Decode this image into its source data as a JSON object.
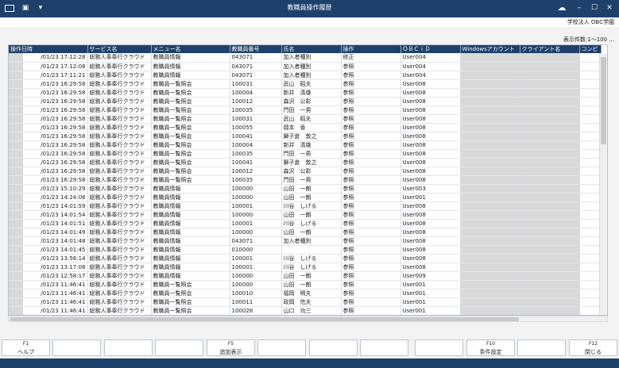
{
  "window": {
    "title": "教職員操作履歴",
    "icons": [
      "window-icon",
      "app-icon",
      "menu-icon"
    ],
    "org": "学校法人 OBC学園",
    "count": "表示件数:1～100 ..."
  },
  "columns": [
    "操作日時",
    "サービス名",
    "メニュー名",
    "教職員番号",
    "氏名",
    "操作",
    "ＯＢＣｉＤ",
    "Windowsアカウント",
    "クライアント名",
    "コンピ"
  ],
  "rows": [
    [
      "/01/23 17:12:28",
      "総務人事奉行クラウド",
      "教職員情報",
      "043071",
      "加入者種別",
      "修正",
      "User004"
    ],
    [
      "/01/23 17:12:08",
      "総務人事奉行クラウド",
      "教職員情報",
      "043071",
      "加入者種別",
      "参照",
      "User004"
    ],
    [
      "/01/23 17:11:21",
      "総務人事奉行クラウド",
      "教職員情報",
      "043071",
      "加入者種別",
      "参照",
      "User004"
    ],
    [
      "/01/23 16:29:58",
      "総務人事奉行クラウド",
      "教職員一覧照会",
      "100031",
      "武山　昭夫",
      "参照",
      "User008"
    ],
    [
      "/01/23 16:29:58",
      "総務人事奉行クラウド",
      "教職員一覧照会",
      "100004",
      "新井　清雄",
      "参照",
      "User008"
    ],
    [
      "/01/23 16:29:58",
      "総務人事奉行クラウド",
      "教職員一覧照会",
      "100012",
      "森沢　公彰",
      "参照",
      "User008"
    ],
    [
      "/01/23 16:29:58",
      "総務人事奉行クラウド",
      "教職員一覧照会",
      "100035",
      "門田　一男",
      "参照",
      "User008"
    ],
    [
      "/01/23 16:29:58",
      "総務人事奉行クラウド",
      "教職員一覧照会",
      "100031",
      "武山　昭夫",
      "参照",
      "User008"
    ],
    [
      "/01/23 16:29:58",
      "総務人事奉行クラウド",
      "教職員一覧照会",
      "100055",
      "岡本　香",
      "参照",
      "User008"
    ],
    [
      "/01/23 16:29:58",
      "総務人事奉行クラウド",
      "教職員一覧照会",
      "100041",
      "獅子倉　敦之",
      "参照",
      "User008"
    ],
    [
      "/01/23 16:29:58",
      "総務人事奉行クラウド",
      "教職員一覧照会",
      "100004",
      "新井　清雄",
      "参照",
      "User008"
    ],
    [
      "/01/23 16:29:58",
      "総務人事奉行クラウド",
      "教職員一覧照会",
      "100035",
      "門田　一男",
      "参照",
      "User008"
    ],
    [
      "/01/23 16:29:58",
      "総務人事奉行クラウド",
      "教職員一覧照会",
      "100041",
      "獅子倉　敦之",
      "参照",
      "User008"
    ],
    [
      "/01/23 16:29:58",
      "総務人事奉行クラウド",
      "教職員一覧照会",
      "100012",
      "森沢　公彰",
      "参照",
      "User008"
    ],
    [
      "/01/23 16:29:58",
      "総務人事奉行クラウド",
      "教職員一覧照会",
      "100035",
      "門田　一男",
      "参照",
      "User008"
    ],
    [
      "/01/23 15:10:29",
      "総務人事奉行クラウド",
      "教職員情報",
      "100000",
      "山田　一朗",
      "参照",
      "User003"
    ],
    [
      "/01/23 14:24:08",
      "総務人事奉行クラウド",
      "教職員情報",
      "100000",
      "山田　一朗",
      "参照",
      "User001"
    ],
    [
      "/01/23 14:01:59",
      "総務人事奉行クラウド",
      "教職員情報",
      "100001",
      "川谷　しげる",
      "参照",
      "User008"
    ],
    [
      "/01/23 14:01:54",
      "総務人事奉行クラウド",
      "教職員情報",
      "100000",
      "山田　一朗",
      "参照",
      "User008"
    ],
    [
      "/01/23 14:01:51",
      "総務人事奉行クラウド",
      "教職員情報",
      "100001",
      "川谷　しげる",
      "参照",
      "User008"
    ],
    [
      "/01/23 14:01:49",
      "総務人事奉行クラウド",
      "教職員情報",
      "100000",
      "山田　一朗",
      "参照",
      "User008"
    ],
    [
      "/01/23 14:01:48",
      "総務人事奉行クラウド",
      "教職員情報",
      "043071",
      "加入者種別",
      "参照",
      "User008"
    ],
    [
      "/01/23 14:01:45",
      "総務人事奉行クラウド",
      "教職員情報",
      "010000",
      "",
      "参照",
      "User008"
    ],
    [
      "/01/23 13:56:14",
      "総務人事奉行クラウド",
      "教職員情報",
      "100001",
      "川谷　しげる",
      "参照",
      "User008"
    ],
    [
      "/01/23 13:17:08",
      "総務人事奉行クラウド",
      "教職員情報",
      "100001",
      "川谷　しげる",
      "参照",
      "User008"
    ],
    [
      "/01/23 12:58:17",
      "総務人事奉行クラウド",
      "教職員情報",
      "100000",
      "山田　一朗",
      "参照",
      "User009"
    ],
    [
      "/01/23 11:46:41",
      "総務人事奉行クラウド",
      "教職員一覧照会",
      "100000",
      "山田　一朗",
      "参照",
      "User001"
    ],
    [
      "/01/23 11:46:41",
      "総務人事奉行クラウド",
      "教職員一覧照会",
      "100010",
      "福岡　明夫",
      "参照",
      "User001"
    ],
    [
      "/01/23 11:46:41",
      "総務人事奉行クラウド",
      "教職員一覧照会",
      "100011",
      "政岡　信夫",
      "参照",
      "User001"
    ],
    [
      "/01/23 11:46:41",
      "総務人事奉行クラウド",
      "教職員一覧照会",
      "100028",
      "山口　功三",
      "参照",
      "User001"
    ]
  ],
  "fkeys": [
    {
      "key": "F1",
      "label": "ヘルプ"
    },
    {
      "key": "",
      "label": ""
    },
    {
      "key": "",
      "label": ""
    },
    {
      "key": "",
      "label": ""
    },
    {
      "key": "F5",
      "label": "追加表示"
    },
    {
      "key": "",
      "label": ""
    },
    {
      "key": "",
      "label": ""
    },
    {
      "key": "",
      "label": ""
    },
    {
      "key": "",
      "label": ""
    },
    {
      "key": "F10",
      "label": "条件設定"
    },
    {
      "key": "",
      "label": ""
    },
    {
      "key": "F12",
      "label": "閉じる"
    }
  ],
  "colors": {
    "titlebar": "#1e416b",
    "header": "#1e416b",
    "mask": "#d9d9d9"
  }
}
